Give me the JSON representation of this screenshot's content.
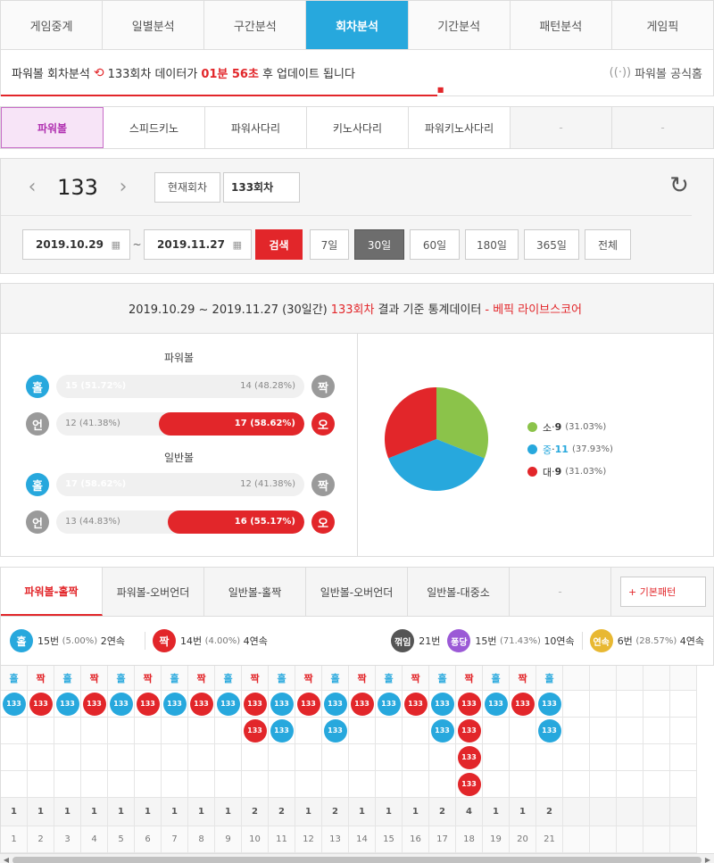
{
  "top_tabs": [
    {
      "label": "게임중계"
    },
    {
      "label": "일별분석"
    },
    {
      "label": "구간분석"
    },
    {
      "label": "회차분석",
      "active": true
    },
    {
      "label": "기간분석"
    },
    {
      "label": "패턴분석"
    },
    {
      "label": "게임픽"
    }
  ],
  "notice": {
    "prefix": "파워볼 회차분석",
    "round": "133회차",
    "mid": "데이터가",
    "time": "01분 56초",
    "suffix": "후 업데이트 됩니다",
    "official": "파워볼 공식홈",
    "progress": 0.6125
  },
  "game_tabs": [
    {
      "label": "파워볼",
      "active": true
    },
    {
      "label": "스피드키노"
    },
    {
      "label": "파워사다리"
    },
    {
      "label": "키노사다리"
    },
    {
      "label": "파워키노사다리"
    },
    {
      "label": "-"
    },
    {
      "label": "-"
    }
  ],
  "round": {
    "number": "133",
    "current_label": "현재회차",
    "input_value": "133회차"
  },
  "range": {
    "start": "2019.10.29",
    "end": "2019.11.27",
    "search": "검색",
    "periods": [
      {
        "label": "7일"
      },
      {
        "label": "30일",
        "active": true
      },
      {
        "label": "60일"
      },
      {
        "label": "180일"
      },
      {
        "label": "365일"
      },
      {
        "label": "전체"
      }
    ]
  },
  "stats": {
    "head_date": "2019.10.29 ~ 2019.11.27 (30일간)",
    "head_round": "133회차",
    "head_mid": "결과 기준 통계데이터",
    "head_brand": "- 베픽 라이브스코어",
    "powerball_title": "파워볼",
    "normal_title": "일반볼",
    "bars": [
      {
        "left_icon": "홀",
        "right_icon": "짝",
        "left_text": "15 (51.72%)",
        "right_text": "14 (48.28%)",
        "left_pct": 51.72,
        "right_pct": 48.28,
        "fill": "left"
      },
      {
        "left_icon": "언",
        "right_icon": "오",
        "left_text": "12 (41.38%)",
        "right_text": "17 (58.62%)",
        "left_pct": 41.38,
        "right_pct": 58.62,
        "fill": "right"
      },
      {
        "left_icon": "홀",
        "right_icon": "짝",
        "left_text": "17 (58.62%)",
        "right_text": "12 (41.38%)",
        "left_pct": 58.62,
        "right_pct": 41.38,
        "fill": "left"
      },
      {
        "left_icon": "언",
        "right_icon": "오",
        "left_text": "13 (44.83%)",
        "right_text": "16 (55.17%)",
        "left_pct": 44.83,
        "right_pct": 55.17,
        "fill": "right"
      }
    ]
  },
  "chart_data": {
    "type": "pie",
    "slices": [
      {
        "label": "소",
        "count": "9",
        "pct": "(31.03%)",
        "value": 31.03,
        "color": "#8bc34a"
      },
      {
        "label": "중",
        "count": "11",
        "pct": "(37.93%)",
        "value": 37.93,
        "color": "#27a8dd"
      },
      {
        "label": "대",
        "count": "9",
        "pct": "(31.03%)",
        "value": 31.03,
        "color": "#e2262a"
      }
    ]
  },
  "pattern_tabs": [
    {
      "label": "파워볼-홀짝",
      "active": true
    },
    {
      "label": "파워볼-오버언더"
    },
    {
      "label": "일반볼-홀짝"
    },
    {
      "label": "일반볼-오버언더"
    },
    {
      "label": "일반볼-대중소"
    },
    {
      "label": "-"
    }
  ],
  "pattern_button": "+ 기본패턴",
  "summary": {
    "odd_icon": "홀",
    "odd_count": "15번",
    "odd_pct": "(5.00%)",
    "odd_streak": "2연속",
    "even_icon": "짝",
    "even_count": "14번",
    "even_pct": "(4.00%)",
    "even_streak": "4연속",
    "break_label": "꺾임",
    "break_count": "21번",
    "pong_label": "퐁당",
    "pong_count": "15번",
    "pong_pct": "(71.43%)",
    "pong_streak": "10연속",
    "streak_label": "연속",
    "streak_count": "6번",
    "streak_pct": "(28.57%)",
    "streak_streak": "4연속"
  },
  "pattern": {
    "ball_label": "133",
    "columns": [
      {
        "type": "홀",
        "count": 1
      },
      {
        "type": "짝",
        "count": 1
      },
      {
        "type": "홀",
        "count": 1
      },
      {
        "type": "짝",
        "count": 1
      },
      {
        "type": "홀",
        "count": 1
      },
      {
        "type": "짝",
        "count": 1
      },
      {
        "type": "홀",
        "count": 1
      },
      {
        "type": "짝",
        "count": 1
      },
      {
        "type": "홀",
        "count": 1
      },
      {
        "type": "짝",
        "count": 2
      },
      {
        "type": "홀",
        "count": 2
      },
      {
        "type": "짝",
        "count": 1
      },
      {
        "type": "홀",
        "count": 2
      },
      {
        "type": "짝",
        "count": 1
      },
      {
        "type": "홀",
        "count": 1
      },
      {
        "type": "짝",
        "count": 1
      },
      {
        "type": "홀",
        "count": 2
      },
      {
        "type": "짝",
        "count": 4
      },
      {
        "type": "홀",
        "count": 1
      },
      {
        "type": "짝",
        "count": 1
      },
      {
        "type": "홀",
        "count": 2
      }
    ]
  },
  "colors": {
    "accent": "#27a8dd",
    "red": "#e2262a",
    "green": "#8bc34a"
  }
}
